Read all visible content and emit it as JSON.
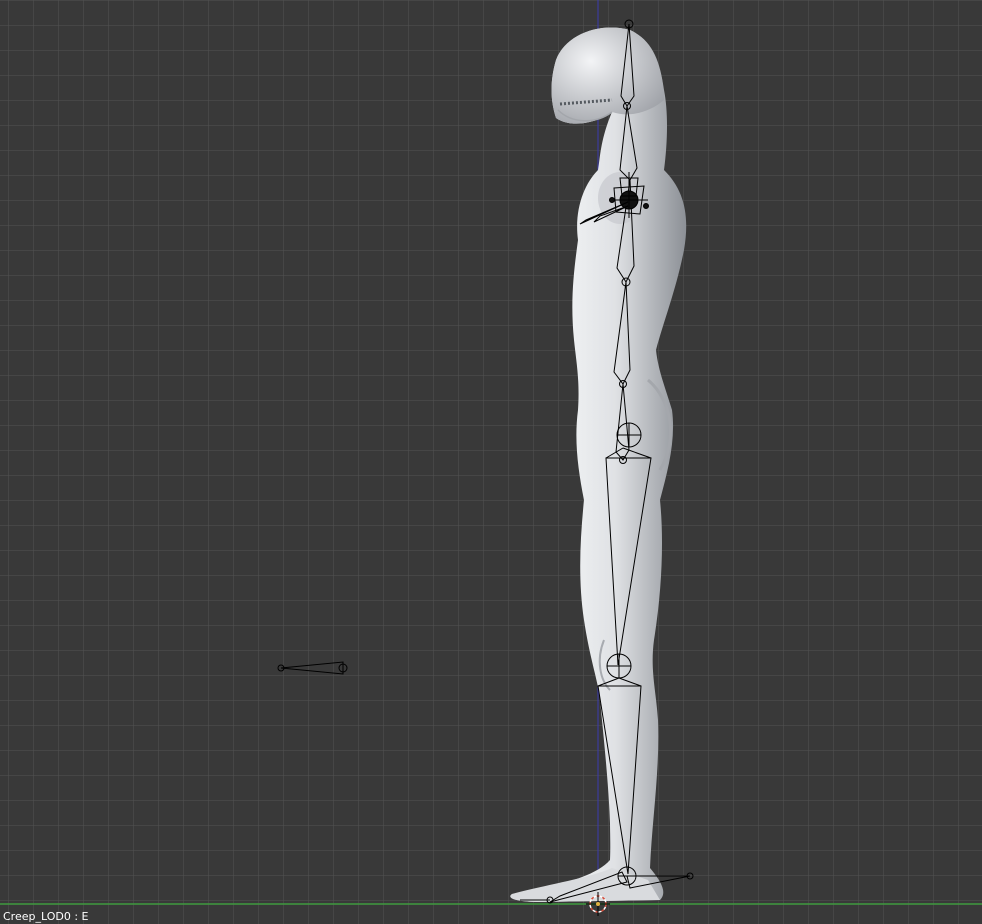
{
  "viewport": {
    "name": "3d-viewport",
    "colors": {
      "background": "#393939",
      "grid": "#505050",
      "z_axis": "#3b3bb0",
      "x_axis": "#3f9a3f",
      "mesh_light": "#eceef0",
      "mesh_shadow": "#8f9298",
      "armature_wire": "#000000",
      "cursor_red": "#d84d3a"
    }
  },
  "status": {
    "object_label": "Creep_LOD0 : E"
  }
}
